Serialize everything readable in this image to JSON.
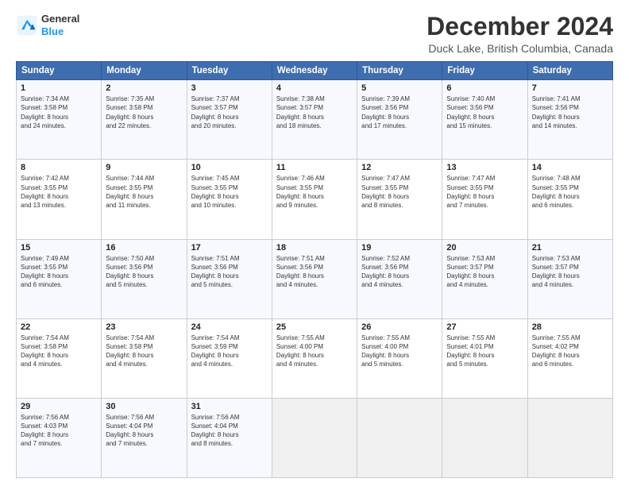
{
  "header": {
    "logo_line1": "General",
    "logo_line2": "Blue",
    "title": "December 2024",
    "subtitle": "Duck Lake, British Columbia, Canada"
  },
  "columns": [
    "Sunday",
    "Monday",
    "Tuesday",
    "Wednesday",
    "Thursday",
    "Friday",
    "Saturday"
  ],
  "weeks": [
    [
      {
        "day": "1",
        "lines": [
          "Sunrise: 7:34 AM",
          "Sunset: 3:58 PM",
          "Daylight: 8 hours",
          "and 24 minutes."
        ]
      },
      {
        "day": "2",
        "lines": [
          "Sunrise: 7:35 AM",
          "Sunset: 3:58 PM",
          "Daylight: 8 hours",
          "and 22 minutes."
        ]
      },
      {
        "day": "3",
        "lines": [
          "Sunrise: 7:37 AM",
          "Sunset: 3:57 PM",
          "Daylight: 8 hours",
          "and 20 minutes."
        ]
      },
      {
        "day": "4",
        "lines": [
          "Sunrise: 7:38 AM",
          "Sunset: 3:57 PM",
          "Daylight: 8 hours",
          "and 18 minutes."
        ]
      },
      {
        "day": "5",
        "lines": [
          "Sunrise: 7:39 AM",
          "Sunset: 3:56 PM",
          "Daylight: 8 hours",
          "and 17 minutes."
        ]
      },
      {
        "day": "6",
        "lines": [
          "Sunrise: 7:40 AM",
          "Sunset: 3:56 PM",
          "Daylight: 8 hours",
          "and 15 minutes."
        ]
      },
      {
        "day": "7",
        "lines": [
          "Sunrise: 7:41 AM",
          "Sunset: 3:56 PM",
          "Daylight: 8 hours",
          "and 14 minutes."
        ]
      }
    ],
    [
      {
        "day": "8",
        "lines": [
          "Sunrise: 7:42 AM",
          "Sunset: 3:55 PM",
          "Daylight: 8 hours",
          "and 13 minutes."
        ]
      },
      {
        "day": "9",
        "lines": [
          "Sunrise: 7:44 AM",
          "Sunset: 3:55 PM",
          "Daylight: 8 hours",
          "and 11 minutes."
        ]
      },
      {
        "day": "10",
        "lines": [
          "Sunrise: 7:45 AM",
          "Sunset: 3:55 PM",
          "Daylight: 8 hours",
          "and 10 minutes."
        ]
      },
      {
        "day": "11",
        "lines": [
          "Sunrise: 7:46 AM",
          "Sunset: 3:55 PM",
          "Daylight: 8 hours",
          "and 9 minutes."
        ]
      },
      {
        "day": "12",
        "lines": [
          "Sunrise: 7:47 AM",
          "Sunset: 3:55 PM",
          "Daylight: 8 hours",
          "and 8 minutes."
        ]
      },
      {
        "day": "13",
        "lines": [
          "Sunrise: 7:47 AM",
          "Sunset: 3:55 PM",
          "Daylight: 8 hours",
          "and 7 minutes."
        ]
      },
      {
        "day": "14",
        "lines": [
          "Sunrise: 7:48 AM",
          "Sunset: 3:55 PM",
          "Daylight: 8 hours",
          "and 6 minutes."
        ]
      }
    ],
    [
      {
        "day": "15",
        "lines": [
          "Sunrise: 7:49 AM",
          "Sunset: 3:55 PM",
          "Daylight: 8 hours",
          "and 6 minutes."
        ]
      },
      {
        "day": "16",
        "lines": [
          "Sunrise: 7:50 AM",
          "Sunset: 3:56 PM",
          "Daylight: 8 hours",
          "and 5 minutes."
        ]
      },
      {
        "day": "17",
        "lines": [
          "Sunrise: 7:51 AM",
          "Sunset: 3:56 PM",
          "Daylight: 8 hours",
          "and 5 minutes."
        ]
      },
      {
        "day": "18",
        "lines": [
          "Sunrise: 7:51 AM",
          "Sunset: 3:56 PM",
          "Daylight: 8 hours",
          "and 4 minutes."
        ]
      },
      {
        "day": "19",
        "lines": [
          "Sunrise: 7:52 AM",
          "Sunset: 3:56 PM",
          "Daylight: 8 hours",
          "and 4 minutes."
        ]
      },
      {
        "day": "20",
        "lines": [
          "Sunrise: 7:53 AM",
          "Sunset: 3:57 PM",
          "Daylight: 8 hours",
          "and 4 minutes."
        ]
      },
      {
        "day": "21",
        "lines": [
          "Sunrise: 7:53 AM",
          "Sunset: 3:57 PM",
          "Daylight: 8 hours",
          "and 4 minutes."
        ]
      }
    ],
    [
      {
        "day": "22",
        "lines": [
          "Sunrise: 7:54 AM",
          "Sunset: 3:58 PM",
          "Daylight: 8 hours",
          "and 4 minutes."
        ]
      },
      {
        "day": "23",
        "lines": [
          "Sunrise: 7:54 AM",
          "Sunset: 3:58 PM",
          "Daylight: 8 hours",
          "and 4 minutes."
        ]
      },
      {
        "day": "24",
        "lines": [
          "Sunrise: 7:54 AM",
          "Sunset: 3:59 PM",
          "Daylight: 8 hours",
          "and 4 minutes."
        ]
      },
      {
        "day": "25",
        "lines": [
          "Sunrise: 7:55 AM",
          "Sunset: 4:00 PM",
          "Daylight: 8 hours",
          "and 4 minutes."
        ]
      },
      {
        "day": "26",
        "lines": [
          "Sunrise: 7:55 AM",
          "Sunset: 4:00 PM",
          "Daylight: 8 hours",
          "and 5 minutes."
        ]
      },
      {
        "day": "27",
        "lines": [
          "Sunrise: 7:55 AM",
          "Sunset: 4:01 PM",
          "Daylight: 8 hours",
          "and 5 minutes."
        ]
      },
      {
        "day": "28",
        "lines": [
          "Sunrise: 7:55 AM",
          "Sunset: 4:02 PM",
          "Daylight: 8 hours",
          "and 6 minutes."
        ]
      }
    ],
    [
      {
        "day": "29",
        "lines": [
          "Sunrise: 7:56 AM",
          "Sunset: 4:03 PM",
          "Daylight: 8 hours",
          "and 7 minutes."
        ]
      },
      {
        "day": "30",
        "lines": [
          "Sunrise: 7:56 AM",
          "Sunset: 4:04 PM",
          "Daylight: 8 hours",
          "and 7 minutes."
        ]
      },
      {
        "day": "31",
        "lines": [
          "Sunrise: 7:56 AM",
          "Sunset: 4:04 PM",
          "Daylight: 8 hours",
          "and 8 minutes."
        ]
      },
      {
        "day": "",
        "lines": []
      },
      {
        "day": "",
        "lines": []
      },
      {
        "day": "",
        "lines": []
      },
      {
        "day": "",
        "lines": []
      }
    ]
  ]
}
